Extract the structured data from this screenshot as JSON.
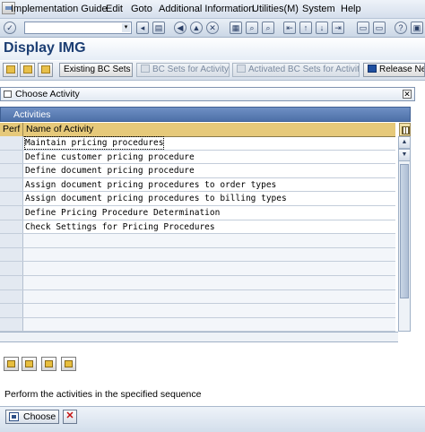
{
  "menu": {
    "items": [
      "Implementation Guide",
      "Edit",
      "Goto",
      "Additional Information",
      "Utilities(M)",
      "System",
      "Help"
    ]
  },
  "toolbar": {
    "command_field_value": "",
    "icons": [
      "enter-icon",
      "save-icon",
      "back-icon",
      "exit-icon",
      "cancel-icon",
      "print-icon",
      "find-icon",
      "find-next-icon",
      "first-page-icon",
      "previous-page-icon",
      "next-page-icon",
      "last-page-icon",
      "new-session-icon",
      "shortcut-icon",
      "help-icon",
      "layout-icon"
    ]
  },
  "title": "Display IMG",
  "app_toolbar": {
    "existing_bc_sets": "Existing BC Sets",
    "bc_sets_for_activity": "BC Sets for Activity",
    "activated_bc_sets": "Activated BC Sets for Activity",
    "release_notes": "Release Ne"
  },
  "dialog": {
    "title": "Choose Activity",
    "table_caption": "Activities",
    "columns": [
      "Perf",
      "Name of Activity"
    ],
    "rows": [
      "Maintain pricing procedures",
      "Define customer pricing procedure",
      "Define document pricing procedure",
      "Assign document pricing procedures to order types",
      "Assign document pricing procedures to billing types",
      "Define Pricing Procedure Determination",
      "Check Settings for Pricing Procedures"
    ],
    "instruction": "Perform the activities in the specified sequence",
    "choose_label": "Choose"
  },
  "colors": {
    "title": "#1c3e73",
    "table_caption": "#4d70a8",
    "column_header": "#e6c97a",
    "cancel": "#c41111"
  }
}
